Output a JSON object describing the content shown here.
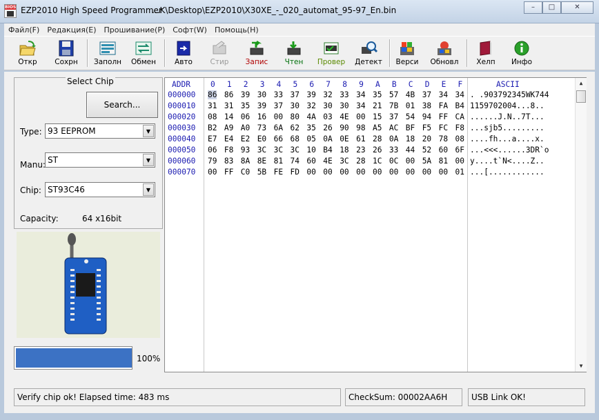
{
  "window": {
    "title": "EZP2010 High Speed Programmer",
    "file_path": "...K\\Desktop\\EZP2010\\X30XE_-_020_automat_95-97_En.bin",
    "controls": [
      "–",
      "□",
      "✕"
    ]
  },
  "menu": [
    "Файл(F)",
    "Редакция(E)",
    "Прошивание(P)",
    "Софт(W)",
    "Помощь(H)"
  ],
  "toolbar": [
    {
      "label": "Откр",
      "icon": "open-folder-icon",
      "enabled": true
    },
    {
      "label": "Сохрн",
      "icon": "save-floppy-icon",
      "enabled": true
    },
    {
      "label": "Заполн",
      "icon": "fill-icon",
      "enabled": true
    },
    {
      "label": "Обмен",
      "icon": "swap-icon",
      "enabled": true
    },
    {
      "label": "Авто",
      "icon": "auto-icon",
      "enabled": true
    },
    {
      "label": "Стир",
      "icon": "erase-icon",
      "enabled": false
    },
    {
      "label": "Запис",
      "icon": "write-icon",
      "enabled": true
    },
    {
      "label": "Чтен",
      "icon": "read-icon",
      "enabled": true
    },
    {
      "label": "Провер",
      "icon": "verify-icon",
      "enabled": true
    },
    {
      "label": "Детект",
      "icon": "detect-icon",
      "enabled": true
    },
    {
      "label": "Верси",
      "icon": "version-icon",
      "enabled": true
    },
    {
      "label": "Обновл",
      "icon": "update-icon",
      "enabled": true
    },
    {
      "label": "Хелп",
      "icon": "help-book-icon",
      "enabled": true
    },
    {
      "label": "Инфо",
      "icon": "info-icon",
      "enabled": true
    }
  ],
  "chip_panel": {
    "group_label": "Select Chip",
    "search_label": "Search...",
    "type_label": "Type:",
    "type_value": "93 EEPROM",
    "manu_label": "Manu:",
    "manu_value": "ST",
    "chip_label": "Chip:",
    "chip_value": "ST93C46",
    "capacity_label": "Capacity:",
    "capacity_value": "64 x16bit"
  },
  "progress": {
    "value": 1.0,
    "text": "100%"
  },
  "hex": {
    "addr_header": "ADDR",
    "columns": [
      "0",
      "1",
      "2",
      "3",
      "4",
      "5",
      "6",
      "7",
      "8",
      "9",
      "A",
      "B",
      "C",
      "D",
      "E",
      "F"
    ],
    "ascii_header": "ASCII",
    "rows": [
      {
        "addr": "000000",
        "bytes": [
          "86",
          "86",
          "39",
          "30",
          "33",
          "37",
          "39",
          "32",
          "33",
          "34",
          "35",
          "57",
          "4B",
          "37",
          "34",
          "34"
        ],
        "ascii": ". .903792345WK744"
      },
      {
        "addr": "000010",
        "bytes": [
          "31",
          "31",
          "35",
          "39",
          "37",
          "30",
          "32",
          "30",
          "30",
          "34",
          "21",
          "7B",
          "01",
          "38",
          "FA",
          "B4"
        ],
        "ascii": "1159702004...8.."
      },
      {
        "addr": "000020",
        "bytes": [
          "08",
          "14",
          "06",
          "16",
          "00",
          "80",
          "4A",
          "03",
          "4E",
          "00",
          "15",
          "37",
          "54",
          "94",
          "FF",
          "CA"
        ],
        "ascii": "......J.N..7T..."
      },
      {
        "addr": "000030",
        "bytes": [
          "B2",
          "A9",
          "A0",
          "73",
          "6A",
          "62",
          "35",
          "26",
          "90",
          "98",
          "A5",
          "AC",
          "BF",
          "F5",
          "FC",
          "F8"
        ],
        "ascii": "...sjb5........."
      },
      {
        "addr": "000040",
        "bytes": [
          "E7",
          "E4",
          "E2",
          "E0",
          "66",
          "68",
          "05",
          "0A",
          "0E",
          "61",
          "28",
          "0A",
          "18",
          "20",
          "78",
          "08"
        ],
        "ascii": "....fh...a....x."
      },
      {
        "addr": "000050",
        "bytes": [
          "06",
          "F8",
          "93",
          "3C",
          "3C",
          "3C",
          "10",
          "B4",
          "18",
          "23",
          "26",
          "33",
          "44",
          "52",
          "60",
          "6F"
        ],
        "ascii": "...<<<......3DR`o"
      },
      {
        "addr": "000060",
        "bytes": [
          "79",
          "83",
          "8A",
          "8E",
          "81",
          "74",
          "60",
          "4E",
          "3C",
          "28",
          "1C",
          "0C",
          "00",
          "5A",
          "81",
          "00"
        ],
        "ascii": "y....t`N<....Z.."
      },
      {
        "addr": "000070",
        "bytes": [
          "00",
          "FF",
          "C0",
          "5B",
          "FE",
          "FD",
          "00",
          "00",
          "00",
          "00",
          "00",
          "00",
          "00",
          "00",
          "00",
          "01"
        ],
        "ascii": "...[............"
      }
    ]
  },
  "status": {
    "message": "Verify chip ok!   Elapsed time: 483 ms",
    "checksum": "CheckSum: 00002AA6H",
    "usb": "USB Link OK!"
  }
}
